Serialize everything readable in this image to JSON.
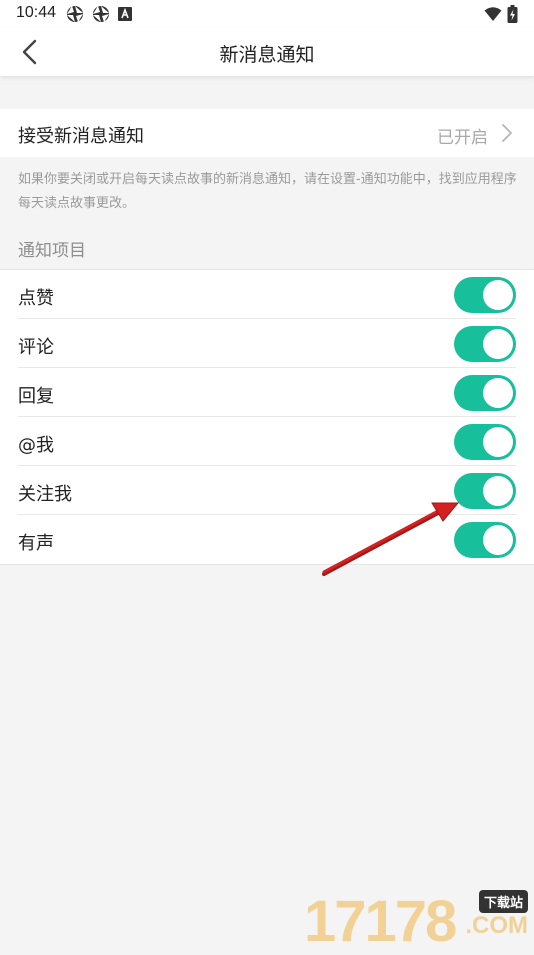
{
  "status_bar": {
    "time": "10:44",
    "left_icons": [
      "aperture-icon",
      "aperture-icon",
      "a-box-icon"
    ],
    "right_icons": [
      "wifi-icon",
      "battery-charging-icon"
    ]
  },
  "nav": {
    "title": "新消息通知",
    "back_icon": "chevron-left-icon"
  },
  "receive": {
    "label": "接受新消息通知",
    "value": "已开启",
    "icon": "chevron-right-icon"
  },
  "hint": "如果你要关闭或开启每天读点故事的新消息通知，请在设置-通知功能中，找到应用程序每天读点故事更改。",
  "section_title": "通知项目",
  "toggles": [
    {
      "label": "点赞",
      "on": true
    },
    {
      "label": "评论",
      "on": true
    },
    {
      "label": "回复",
      "on": true
    },
    {
      "label": "@我",
      "on": true
    },
    {
      "label": "关注我",
      "on": true
    },
    {
      "label": "有声",
      "on": true
    }
  ],
  "colors": {
    "switch_on": "#17bf9b",
    "hint_text": "#9a9a9a",
    "annotation_arrow": "#d42020"
  },
  "watermark": {
    "digits": "17178",
    "badge": "下载站",
    "suffix": ".COM"
  }
}
